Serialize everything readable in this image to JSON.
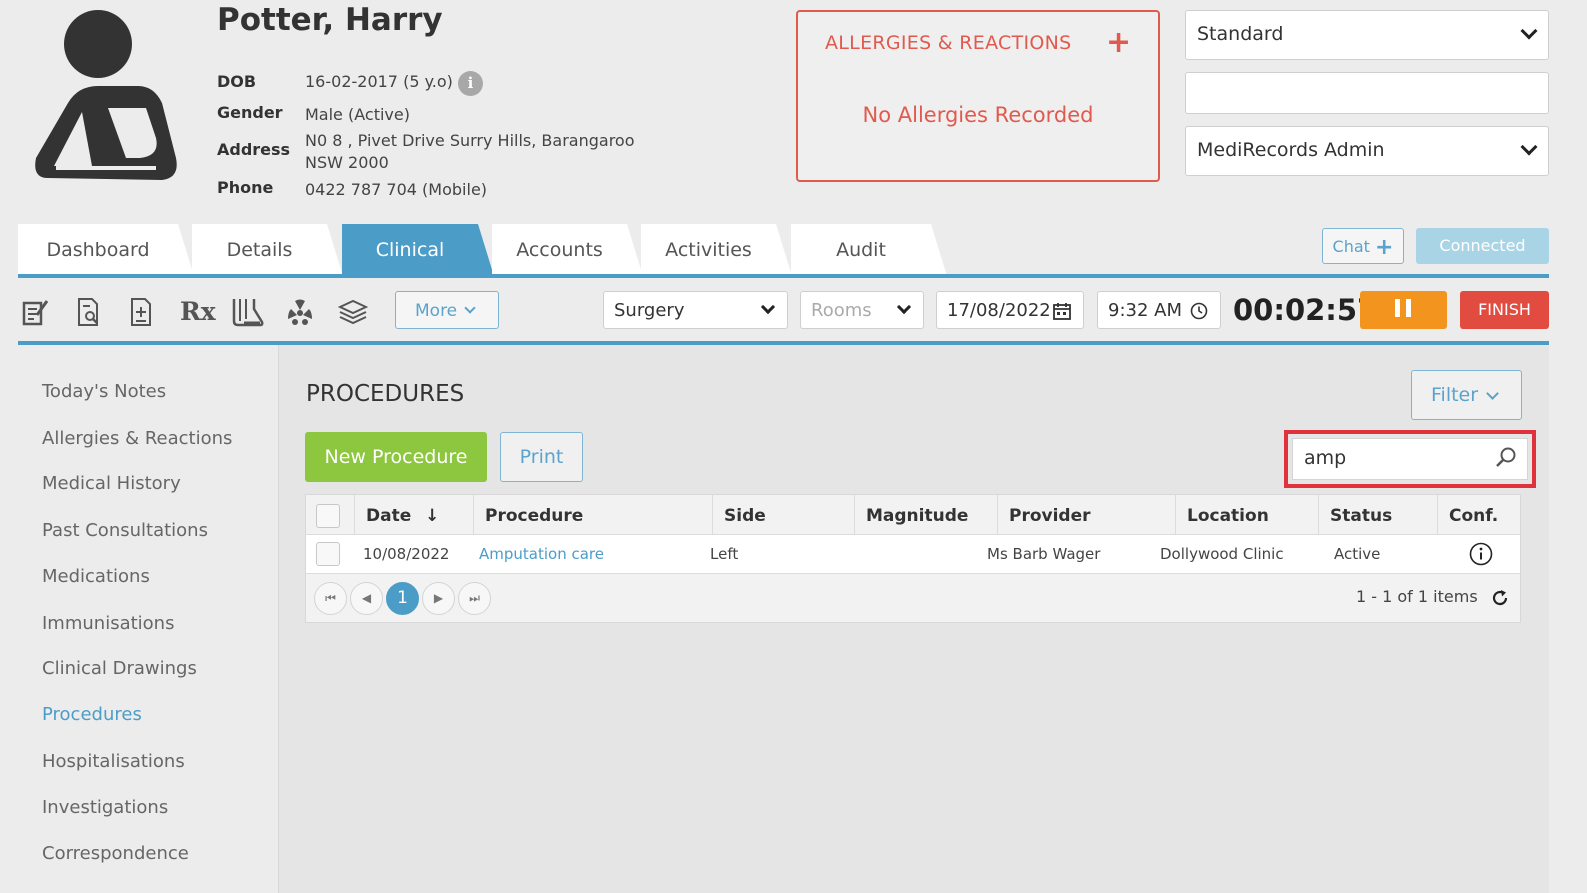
{
  "patient": {
    "name": "Potter, Harry",
    "dob_label": "DOB",
    "dob_value": "16-02-2017 (5 y.o)",
    "gender_label": "Gender",
    "gender_value": "Male (Active)",
    "address_label": "Address",
    "address_line1": "N0 8 , Pivet Drive Surry Hills, Barangaroo",
    "address_line2": "NSW 2000",
    "phone_label": "Phone",
    "phone_value": "0422 787 704 (Mobile)"
  },
  "allergies": {
    "title": "ALLERGIES & REACTIONS",
    "add_icon": "+",
    "empty_text": "No Allergies Recorded"
  },
  "header_selects": {
    "template": "Standard",
    "blank": "",
    "user": "MediRecords Admin"
  },
  "tabs": [
    {
      "label": "Dashboard"
    },
    {
      "label": "Details"
    },
    {
      "label": "Clinical"
    },
    {
      "label": "Accounts"
    },
    {
      "label": "Activities"
    },
    {
      "label": "Audit"
    }
  ],
  "active_tab": "Clinical",
  "chat": {
    "label": "Chat",
    "plus": "+"
  },
  "connection_status": "Connected",
  "toolbar": {
    "icons": [
      "notes-icon",
      "document-search-icon",
      "document-plus-icon",
      "rx-icon",
      "lab-flask-icon",
      "radiation-icon",
      "stack-icon"
    ],
    "rx_label": "Rx",
    "more_label": "More",
    "location": "Surgery",
    "rooms_placeholder": "Rooms",
    "date": "17/08/2022",
    "time": "9:32 AM",
    "timer": "00:02:57",
    "finish_label": "FINISH"
  },
  "sidebar": {
    "items": [
      {
        "label": "Today's Notes"
      },
      {
        "label": "Allergies & Reactions"
      },
      {
        "label": "Medical History"
      },
      {
        "label": "Past Consultations"
      },
      {
        "label": "Medications"
      },
      {
        "label": "Immunisations"
      },
      {
        "label": "Clinical Drawings"
      },
      {
        "label": "Procedures"
      },
      {
        "label": "Hospitalisations"
      },
      {
        "label": "Investigations"
      },
      {
        "label": "Correspondence"
      }
    ],
    "active": "Procedures"
  },
  "procedures": {
    "title": "PROCEDURES",
    "filter_label": "Filter",
    "new_label": "New Procedure",
    "print_label": "Print",
    "search_value": "amp",
    "columns": [
      "Date",
      "Procedure",
      "Side",
      "Magnitude",
      "Provider",
      "Location",
      "Status",
      "Conf."
    ],
    "sort_indicator": "↓",
    "rows": [
      {
        "date": "10/08/2022",
        "procedure": "Amputation care",
        "side": "Left",
        "magnitude": "",
        "provider": "Ms Barb Wager",
        "location": "Dollywood Clinic",
        "status": "Active"
      }
    ],
    "pager": {
      "current_page": "1",
      "info": "1 - 1 of 1 items"
    }
  },
  "colors": {
    "accent": "#4b9dc8",
    "allergy_red": "#e05a4e",
    "new_green": "#8dc63f",
    "pause_orange": "#f3941e",
    "finish_red": "#e24b3f",
    "highlight_red": "#e0323a"
  }
}
